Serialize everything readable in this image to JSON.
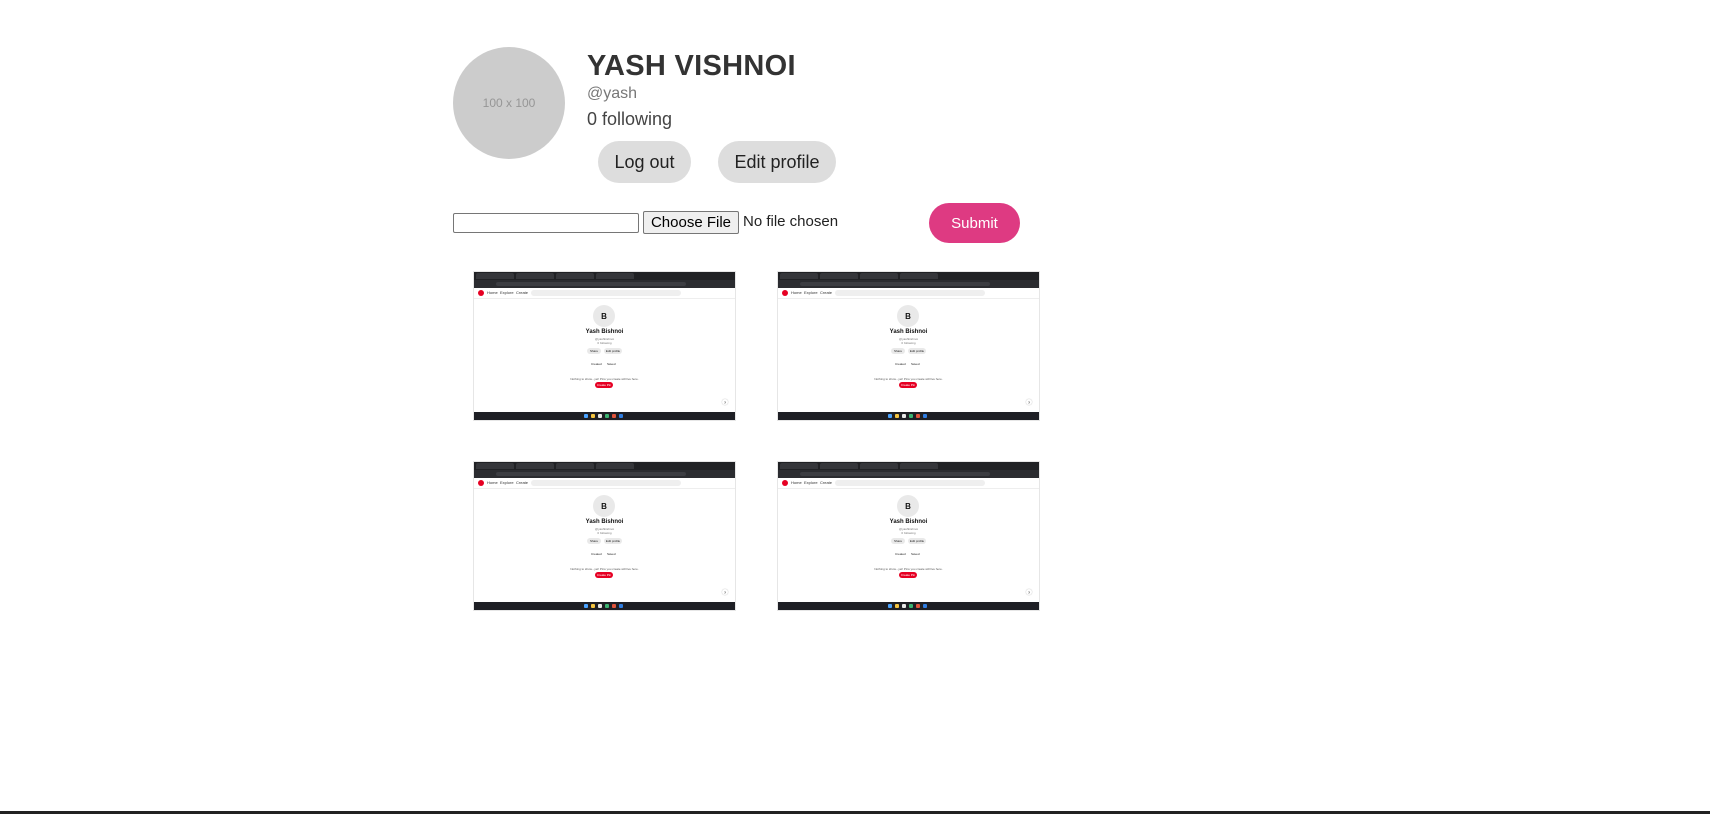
{
  "profile": {
    "avatar_placeholder": "100 x 100",
    "name": "YASH VISHNOI",
    "handle": "@yash",
    "following": "0 following",
    "logout_label": "Log out",
    "edit_label": "Edit profile"
  },
  "upload": {
    "text_value": "",
    "choose_label": "Choose File",
    "file_status": "No file chosen",
    "submit_label": "Submit"
  },
  "thumbnail": {
    "nav_home": "Home",
    "nav_explore": "Explore",
    "nav_create": "Create",
    "search_placeholder": "Search",
    "avatar_letter": "B",
    "name": "Yash Bishnoi",
    "handle_line": "@yashbishnoi",
    "following_line": "0 following",
    "share_label": "Share",
    "edit_label": "Edit profile",
    "tab_created": "Created",
    "tab_saved": "Saved",
    "empty_message": "Nothing to show...yet! Pins you create will live here.",
    "create_pin_label": "Create Pin",
    "help_glyph": "?"
  },
  "colors": {
    "accent": "#de3a82",
    "pinterest_red": "#e60023",
    "button_gray": "#dddddd",
    "avatar_gray": "#cccccc"
  }
}
